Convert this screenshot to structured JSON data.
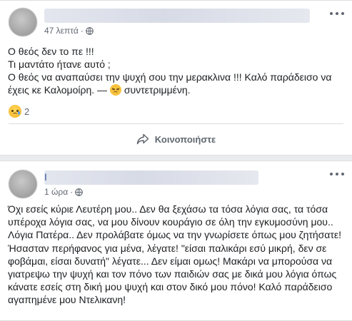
{
  "posts": [
    {
      "time": "47 λεπτά",
      "separator": "·",
      "lines": [
        "Ο θεός δεν το πε !!!",
        "Τι μαντάτο ήτανε αυτό ;",
        "Ο θεός να αναπαύσει την ψυχή σου την μερακλινα !!! Καλό παράδεισο να έχεις κε Καλομοίρη. — ",
        "συντετριμμένη."
      ],
      "reaction_count": "2",
      "share_label": "Κοινοποιήστε"
    },
    {
      "name_initial": "I",
      "time": "1 ώρα",
      "separator": "·",
      "body": "Όχι εσείς κύριε Λευτέρη μου.. Δεν θα ξεχάσω τα τόσα λόγια σας, τα τόσα υπέροχα λόγια σας, να μου δίνουν κουράγιο σε όλη την εγκυμοσύνη μου.. Λόγια Πατέρα.. Δεν προλάβατε όμως να την γνωρίσετε όπως μου ζητήσατε! Ήσασταν περήφανος για μένα, λέγατε! \"είσαι παλικάρι εσύ μικρή, δεν σε φοβάμαι, είσαι δυνατή\" λέγατε... Δεν είμαι ομως! Μακάρι να μπορούσα να γιατρεψω την ψυχή και τον πόνο των παιδιών σας με δικά μου λόγια όπως κάνατε εσείς στη δική μου ψυχή και στον δικό μου πόνο! Καλό παράδεισο αγαπημένε μου Ντελικανη!"
    }
  ],
  "icons": {
    "globe": "globe-icon",
    "more": "more-options-icon",
    "share": "share-arrow-icon",
    "reaction": "sad-reaction-icon",
    "feeling": "sad-face-emoji-icon"
  },
  "colors": {
    "background": "#e9ebee",
    "card": "#ffffff",
    "text": "#1c1e21",
    "meta": "#616770"
  }
}
